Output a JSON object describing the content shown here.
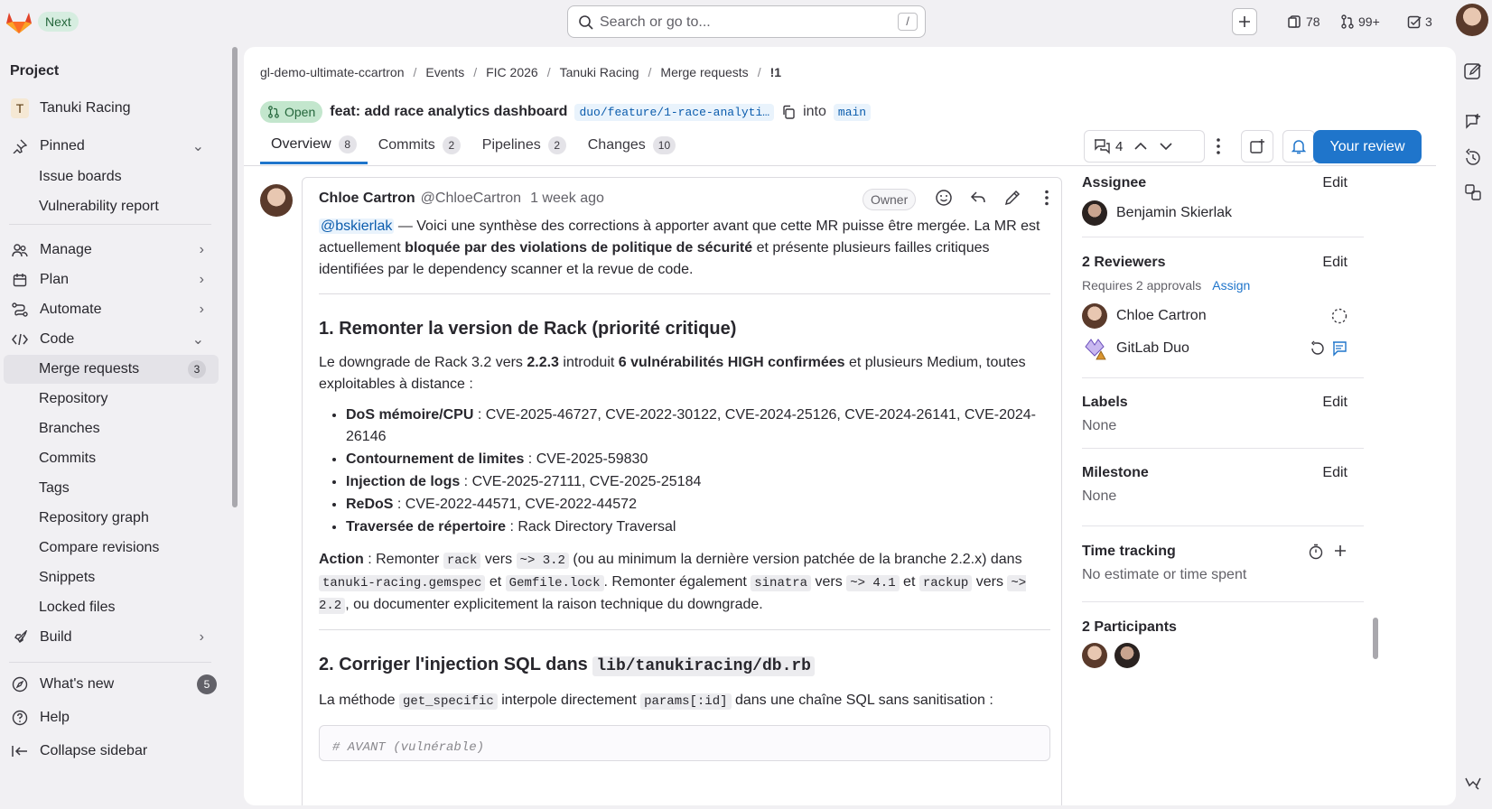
{
  "topbar": {
    "next_label": "Next",
    "search_placeholder": "Search or go to...",
    "search_shortcut": "/",
    "issues_count": "78",
    "mr_count": "99+",
    "todos_count": "3"
  },
  "sidebar": {
    "title": "Project",
    "project_initial": "T",
    "project_name": "Tanuki Racing",
    "pinned": "Pinned",
    "pinned_items": [
      "Issue boards",
      "Vulnerability report"
    ],
    "sections": [
      "Manage",
      "Plan",
      "Automate",
      "Code"
    ],
    "code_items": [
      {
        "label": "Merge requests",
        "badge": "3"
      },
      {
        "label": "Repository"
      },
      {
        "label": "Branches"
      },
      {
        "label": "Commits"
      },
      {
        "label": "Tags"
      },
      {
        "label": "Repository graph"
      },
      {
        "label": "Compare revisions"
      },
      {
        "label": "Snippets"
      },
      {
        "label": "Locked files"
      }
    ],
    "build": "Build",
    "whats_new": "What's new",
    "whats_new_badge": "5",
    "help": "Help",
    "collapse": "Collapse sidebar"
  },
  "breadcrumb": [
    "gl-demo-ultimate-ccartron",
    "Events",
    "FIC 2026",
    "Tanuki Racing",
    "Merge requests",
    "!1"
  ],
  "mr": {
    "status": "Open",
    "title": "feat: add race analytics dashboard",
    "source_branch": "duo/feature/1-race-analyti…",
    "into": "into",
    "target_branch": "main"
  },
  "tabs": [
    {
      "label": "Overview",
      "count": "8"
    },
    {
      "label": "Commits",
      "count": "2"
    },
    {
      "label": "Pipelines",
      "count": "2"
    },
    {
      "label": "Changes",
      "count": "10"
    }
  ],
  "actions": {
    "threads": "4",
    "review_button": "Your review"
  },
  "comment": {
    "author": "Chloe Cartron",
    "handle": "@ChloeCartron",
    "time": "1 week ago",
    "role": "Owner",
    "mention": "@bskierlak",
    "intro_1": " — Voici une synthèse des corrections à apporter avant que cette MR puisse être mergée. La MR est actuellement ",
    "intro_bold": "bloquée par des violations de politique de sécurité",
    "intro_2": " et présente plusieurs failles critiques identifiées par le dependency scanner et la revue de code.",
    "h1": "1. Remonter la version de Rack (priorité critique)",
    "p1_a": "Le downgrade de Rack 3.2 vers ",
    "p1_b": "2.2.3",
    "p1_c": " introduit ",
    "p1_d": "6 vulnérabilités HIGH confirmées",
    "p1_e": " et plusieurs Medium, toutes exploitables à distance :",
    "vulns": [
      {
        "k": "DoS mémoire/CPU",
        "v": " : CVE-2025-46727, CVE-2022-30122, CVE-2024-25126, CVE-2024-26141, CVE-2024-26146"
      },
      {
        "k": "Contournement de limites",
        "v": " : CVE-2025-59830"
      },
      {
        "k": "Injection de logs",
        "v": " : CVE-2025-27111, CVE-2025-25184"
      },
      {
        "k": "ReDoS",
        "v": " : CVE-2022-44571, CVE-2022-44572"
      },
      {
        "k": "Traversée de répertoire",
        "v": " : Rack Directory Traversal"
      }
    ],
    "action_label": "Action",
    "a1": " : Remonter ",
    "c_rack": "rack",
    "a2": " vers ",
    "c_v32": "~> 3.2",
    "a3": " (ou au minimum la dernière version patchée de la branche 2.2.x) dans ",
    "c_gemspec": "tanuki-racing.gemspec",
    "a4": " et ",
    "c_gemfile": "Gemfile.lock",
    "a5": ". Remonter également ",
    "c_sinatra": "sinatra",
    "a6": " vers ",
    "c_v41": "~> 4.1",
    "a7": " et ",
    "c_rackup": "rackup",
    "a8": " vers ",
    "c_v22": "~> 2.2",
    "a9": ", ou documenter explicitement la raison technique du downgrade.",
    "h2_text": "2. Corriger l'injection SQL dans ",
    "h2_code": "lib/tanukiracing/db.rb",
    "p2_a": "La méthode ",
    "c_getspec": "get_specific",
    "p2_b": " interpole directement ",
    "c_params": "params[:id]",
    "p2_c": " dans une chaîne SQL sans sanitisation :",
    "code_line": "# AVANT (vulnérable)"
  },
  "panel": {
    "assignee_title": "Assignee",
    "edit": "Edit",
    "assignee_name": "Benjamin Skierlak",
    "reviewers_title": "2 Reviewers",
    "requires": "Requires 2 approvals",
    "assign": "Assign",
    "reviewer_1": "Chloe Cartron",
    "reviewer_2": "GitLab Duo",
    "labels_title": "Labels",
    "labels_value": "None",
    "milestone_title": "Milestone",
    "milestone_value": "None",
    "time_title": "Time tracking",
    "time_value": "No estimate or time spent",
    "participants_title": "2 Participants"
  },
  "colors": {
    "accent": "#1f75cb",
    "open_badge": "#c3e6cd",
    "brand": "#e24329"
  }
}
